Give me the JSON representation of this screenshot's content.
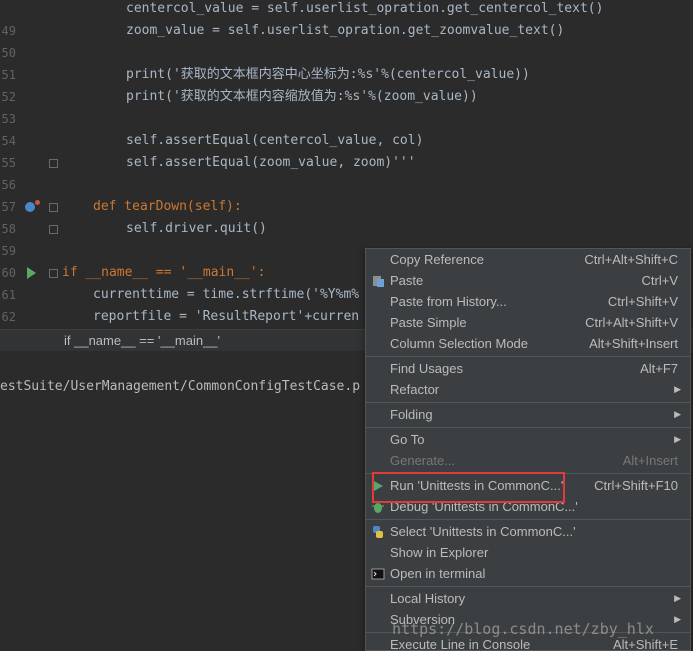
{
  "editor": {
    "lines": [
      {
        "num": "",
        "code": "centercol_value = self.userlist_opration.get_centercol_text()"
      },
      {
        "num": "49",
        "code": "zoom_value = self.userlist_opration.get_zoomvalue_text()"
      },
      {
        "num": "50",
        "code": ""
      },
      {
        "num": "51",
        "code": "print('获取的文本框内容中心坐标为:%s'%(centercol_value))"
      },
      {
        "num": "52",
        "code": "print('获取的文本框内容缩放值为:%s'%(zoom_value))"
      },
      {
        "num": "53",
        "code": ""
      },
      {
        "num": "54",
        "code": "self.assertEqual(centercol_value, col)"
      },
      {
        "num": "55",
        "code": "self.assertEqual(zoom_value, zoom)'''"
      },
      {
        "num": "56",
        "code": ""
      },
      {
        "num": "57",
        "code": "def tearDown(self):"
      },
      {
        "num": "58",
        "code": "self.driver.quit()"
      },
      {
        "num": "59",
        "code": ""
      },
      {
        "num": "60",
        "code": "if __name__ == '__main__':"
      },
      {
        "num": "61",
        "code": "currenttime = time.strftime('%Y%m%"
      },
      {
        "num": "62",
        "code": "reportfile = 'ResultReport'+curren"
      }
    ],
    "breadcrumb": "if __name__ == '__main__'"
  },
  "terminal": {
    "path_text": "estSuite/UserManagement/CommonConfigTestCase.p"
  },
  "context_menu": {
    "items": [
      {
        "label": "Copy Reference",
        "shortcut": "Ctrl+Alt+Shift+C"
      },
      {
        "label": "Paste",
        "shortcut": "Ctrl+V",
        "icon": "paste-icon"
      },
      {
        "label": "Paste from History...",
        "shortcut": "Ctrl+Shift+V"
      },
      {
        "label": "Paste Simple",
        "shortcut": "Ctrl+Alt+Shift+V"
      },
      {
        "label": "Column Selection Mode",
        "shortcut": "Alt+Shift+Insert"
      },
      {
        "label": "Find Usages",
        "shortcut": "Alt+F7"
      },
      {
        "label": "Refactor",
        "submenu": true
      },
      {
        "label": "Folding",
        "submenu": true
      },
      {
        "label": "Go To",
        "submenu": true
      },
      {
        "label": "Generate...",
        "shortcut": "Alt+Insert",
        "disabled": true
      },
      {
        "label": "Run 'Unittests in CommonC...'",
        "shortcut": "Ctrl+Shift+F10",
        "icon": "run-icon"
      },
      {
        "label": "Debug 'Unittests in CommonC...'",
        "icon": "debug-icon"
      },
      {
        "label": "Select 'Unittests in CommonC...'",
        "icon": "python-icon"
      },
      {
        "label": "Show in Explorer"
      },
      {
        "label": "Open in terminal",
        "icon": "terminal-icon"
      },
      {
        "label": "Local History",
        "submenu": true
      },
      {
        "label": "Subversion",
        "submenu": true
      },
      {
        "label": "Execute Line in Console",
        "shortcut": "Alt+Shift+E"
      }
    ]
  },
  "watermark": "https://blog.csdn.net/zby_hlx",
  "colors": {
    "editor_bg": "#2b2b2b",
    "menu_bg": "#3c3f41",
    "highlight_border": "#e03a3a",
    "keyword": "#cc7832",
    "string": "#6a8759",
    "function": "#ffc66d"
  }
}
